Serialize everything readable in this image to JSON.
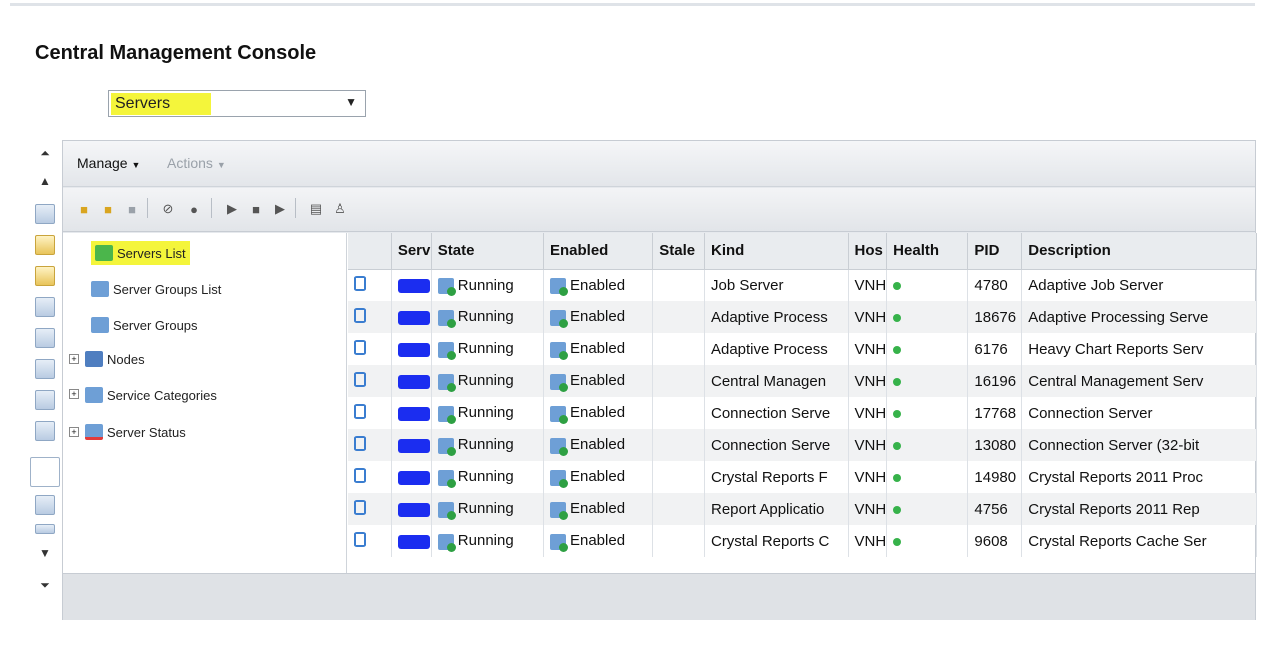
{
  "app": {
    "title": "Central Management Console"
  },
  "nav_select": {
    "value": "Servers"
  },
  "menubar": {
    "manage": "Manage",
    "actions": "Actions"
  },
  "tree": {
    "items": [
      {
        "label": "Servers List"
      },
      {
        "label": "Server Groups List"
      },
      {
        "label": "Server Groups"
      },
      {
        "label": "Nodes"
      },
      {
        "label": "Service Categories"
      },
      {
        "label": "Server Status"
      }
    ]
  },
  "table": {
    "columns": [
      "",
      "Serv",
      "State",
      "Enabled",
      "Stale",
      "Kind",
      "Hos",
      "Health",
      "PID",
      "Description"
    ],
    "rows": [
      {
        "state": "Running",
        "enabled": "Enabled",
        "kind": "Job Server",
        "host": "VNH",
        "pid": "4780",
        "description": "Adaptive Job Server"
      },
      {
        "state": "Running",
        "enabled": "Enabled",
        "kind": "Adaptive Process",
        "host": "VNH",
        "pid": "18676",
        "description": "Adaptive Processing Serve"
      },
      {
        "state": "Running",
        "enabled": "Enabled",
        "kind": "Adaptive Process",
        "host": "VNH",
        "pid": "6176",
        "description": "Heavy Chart Reports Serv"
      },
      {
        "state": "Running",
        "enabled": "Enabled",
        "kind": "Central Managen",
        "host": "VNH",
        "pid": "16196",
        "description": "Central Management Serv"
      },
      {
        "state": "Running",
        "enabled": "Enabled",
        "kind": "Connection Serve",
        "host": "VNH",
        "pid": "17768",
        "description": "Connection Server"
      },
      {
        "state": "Running",
        "enabled": "Enabled",
        "kind": "Connection Serve",
        "host": "VNH",
        "pid": "13080",
        "description": "Connection Server (32-bit"
      },
      {
        "state": "Running",
        "enabled": "Enabled",
        "kind": "Crystal Reports F",
        "host": "VNH",
        "pid": "14980",
        "description": "Crystal Reports 2011 Proc"
      },
      {
        "state": "Running",
        "enabled": "Enabled",
        "kind": "Report Applicatio",
        "host": "VNH",
        "pid": "4756",
        "description": "Crystal Reports 2011 Rep"
      },
      {
        "state": "Running",
        "enabled": "Enabled",
        "kind": "Crystal Reports C",
        "host": "VNH",
        "pid": "9608",
        "description": "Crystal Reports Cache Ser"
      }
    ]
  },
  "colors": {
    "highlight": "#f4f53b",
    "health_ok": "#36b24a",
    "redaction": "#1b2df0"
  }
}
